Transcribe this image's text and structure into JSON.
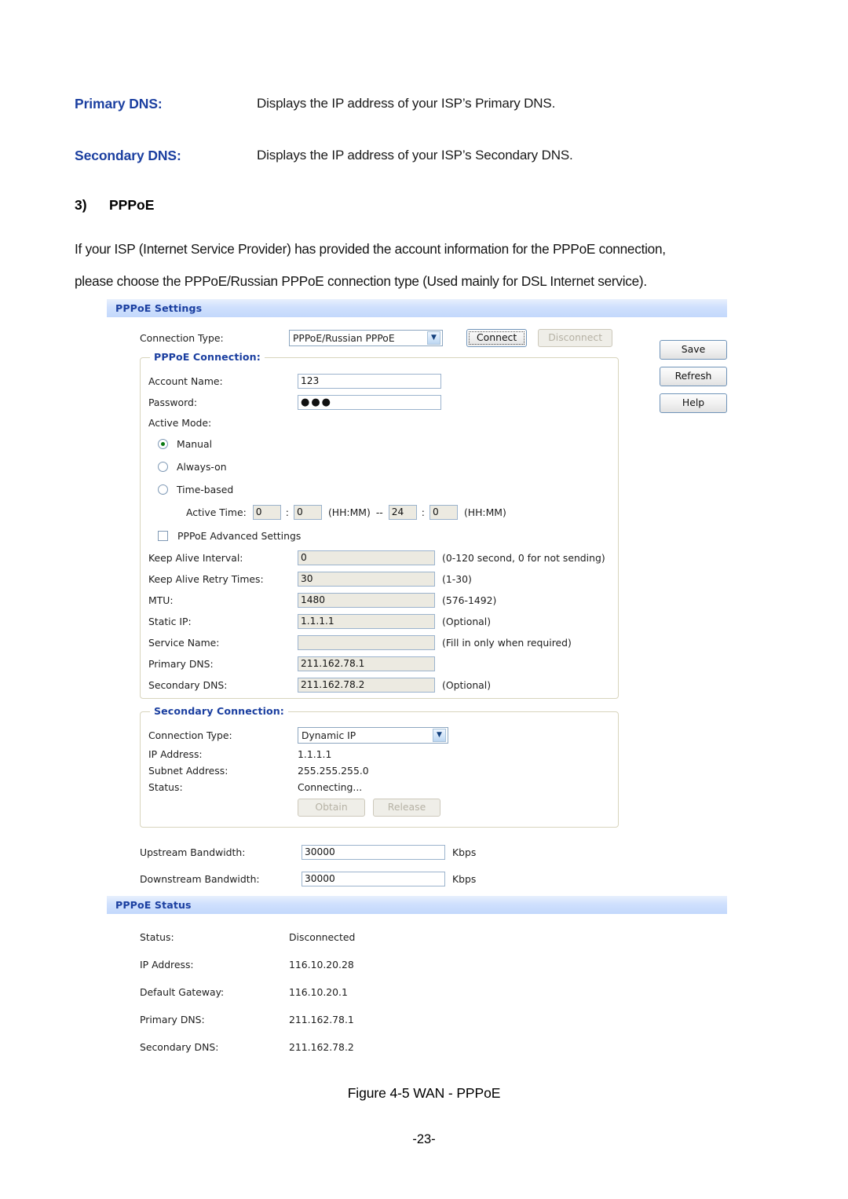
{
  "document": {
    "definitions": [
      {
        "term": "Primary DNS:",
        "desc": "Displays the IP address of your ISP’s Primary DNS."
      },
      {
        "term": "Secondary DNS:",
        "desc": "Displays the IP address of your ISP’s Secondary DNS."
      }
    ],
    "section_number": "3)",
    "section_title": "PPPoE",
    "paragraph_line1": "If your ISP (Internet Service Provider) has provided the account information for the PPPoE connection,",
    "paragraph_line2": "please choose the PPPoE/Russian PPPoE connection type (Used mainly for DSL Internet service).",
    "figure_caption": "Figure 4-5 WAN - PPPoE",
    "page_number": "-23-"
  },
  "screenshot": {
    "settings_panel": {
      "header": "PPPoE Settings",
      "connection_type_label": "Connection Type:",
      "connection_type_value": "PPPoE/Russian PPPoE",
      "connect_button": "Connect",
      "disconnect_button": "Disconnect",
      "side_buttons": [
        "Save",
        "Refresh",
        "Help"
      ],
      "pppoe_connection": {
        "legend": "PPPoE Connection:",
        "account_name_label": "Account Name:",
        "account_name_value": "123",
        "password_label": "Password:",
        "password_value": "●●●",
        "active_mode_label": "Active Mode:",
        "modes": [
          {
            "label": "Manual",
            "selected": true
          },
          {
            "label": "Always-on",
            "selected": false
          },
          {
            "label": "Time-based",
            "selected": false
          }
        ],
        "active_time_label": "Active Time:",
        "active_time_start_hh": "0",
        "active_time_start_mm": "0",
        "active_time_sep1": ":",
        "active_time_format1": "(HH:MM)",
        "active_time_dash": "--",
        "active_time_end_hh": "24",
        "active_time_end_mm": "0",
        "active_time_sep2": ":",
        "active_time_format2": "(HH:MM)",
        "advanced_checkbox_label": "PPPoE Advanced Settings",
        "advanced_checkbox_checked": false,
        "fields": [
          {
            "label": "Keep Alive Interval:",
            "value": "0",
            "hint": "(0-120 second, 0 for not sending)"
          },
          {
            "label": "Keep Alive Retry Times:",
            "value": "30",
            "hint": "(1-30)"
          },
          {
            "label": "MTU:",
            "value": "1480",
            "hint": "(576-1492)"
          },
          {
            "label": "Static IP:",
            "value": "1.1.1.1",
            "hint": "(Optional)"
          },
          {
            "label": "Service Name:",
            "value": "",
            "hint": "(Fill in only when required)"
          },
          {
            "label": "Primary DNS:",
            "value": "211.162.78.1",
            "hint": ""
          },
          {
            "label": "Secondary DNS:",
            "value": "211.162.78.2",
            "hint": "(Optional)"
          }
        ]
      },
      "secondary_connection": {
        "legend": "Secondary Connection:",
        "connection_type_label": "Connection Type:",
        "connection_type_value": "Dynamic IP",
        "rows": [
          {
            "label": "IP Address:",
            "value": "1.1.1.1"
          },
          {
            "label": "Subnet Address:",
            "value": "255.255.255.0"
          },
          {
            "label": "Status:",
            "value": "Connecting..."
          }
        ],
        "obtain_button": "Obtain",
        "release_button": "Release"
      },
      "bandwidth": [
        {
          "label": "Upstream Bandwidth:",
          "value": "30000",
          "unit": "Kbps"
        },
        {
          "label": "Downstream Bandwidth:",
          "value": "30000",
          "unit": "Kbps"
        }
      ]
    },
    "status_panel": {
      "header": "PPPoE Status",
      "rows": [
        {
          "label": "Status:",
          "value": "Disconnected"
        },
        {
          "label": "IP Address:",
          "value": "116.10.20.28"
        },
        {
          "label": "Default Gateway:",
          "value": "116.10.20.1"
        },
        {
          "label": "Primary DNS:",
          "value": "211.162.78.1"
        },
        {
          "label": "Secondary DNS:",
          "value": "211.162.78.2"
        }
      ]
    }
  },
  "colors": {
    "heading_blue": "#1B3FA0",
    "panel_bar": "#c9dcfc"
  }
}
